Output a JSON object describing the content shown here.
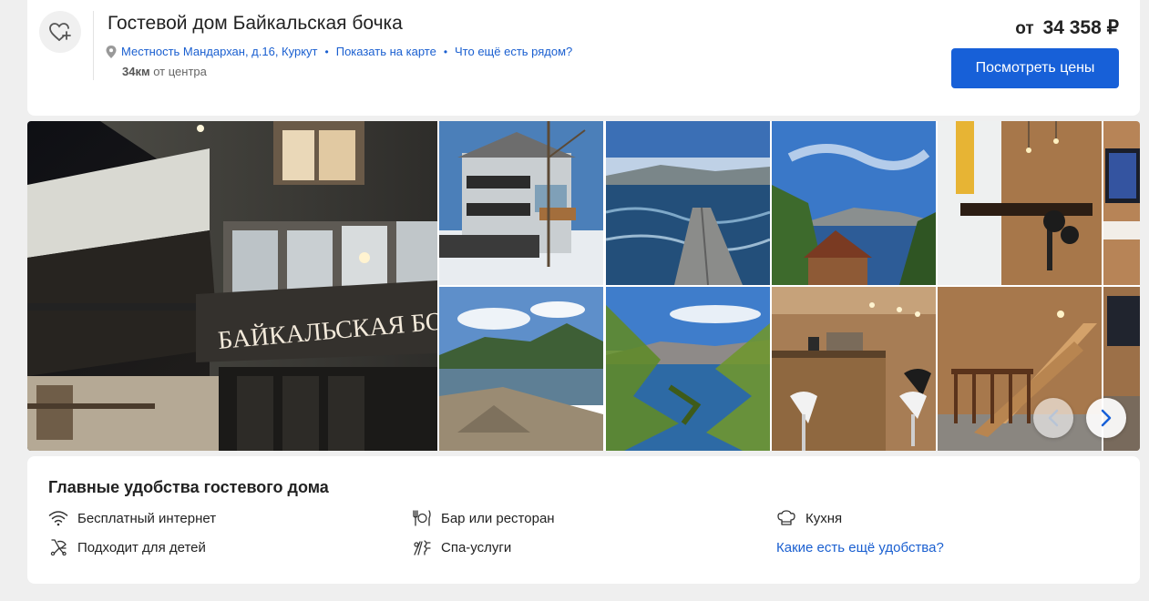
{
  "hotel": {
    "title": "Гостевой дом Байкальская бочка",
    "address": "Местность Мандархан, д.16, Куркут",
    "show_on_map": "Показать на карте",
    "nearby": "Что ещё есть рядом?",
    "distance_value": "34км",
    "distance_suffix": "от центра",
    "separator": "•"
  },
  "pricing": {
    "from": "от",
    "amount": "34 358 ₽",
    "button": "Посмотреть цены"
  },
  "gallery": {
    "photos": [
      {
        "alt": "Фасад ночью"
      },
      {
        "alt": "Дом зимой"
      },
      {
        "alt": "Причал на Байкале"
      },
      {
        "alt": "Вид на озеро"
      },
      {
        "alt": "Барная стойка"
      },
      {
        "alt": "Холмы и озеро"
      },
      {
        "alt": "Озеро сквозь хвою"
      },
      {
        "alt": "Бар в интерьере"
      },
      {
        "alt": "Лестница"
      }
    ]
  },
  "amenities": {
    "title": "Главные удобства гостевого дома",
    "items": [
      {
        "label": "Бесплатный интернет",
        "icon": "wifi-icon"
      },
      {
        "label": "Бар или ресторан",
        "icon": "dining-icon"
      },
      {
        "label": "Кухня",
        "icon": "chef-hat-icon"
      },
      {
        "label": "Подходит для детей",
        "icon": "stroller-icon"
      },
      {
        "label": "Спа-услуги",
        "icon": "spa-icon"
      }
    ],
    "more_link": "Какие есть ещё удобства?"
  },
  "colors": {
    "accent": "#1760d8",
    "link": "#1a5fd0"
  }
}
